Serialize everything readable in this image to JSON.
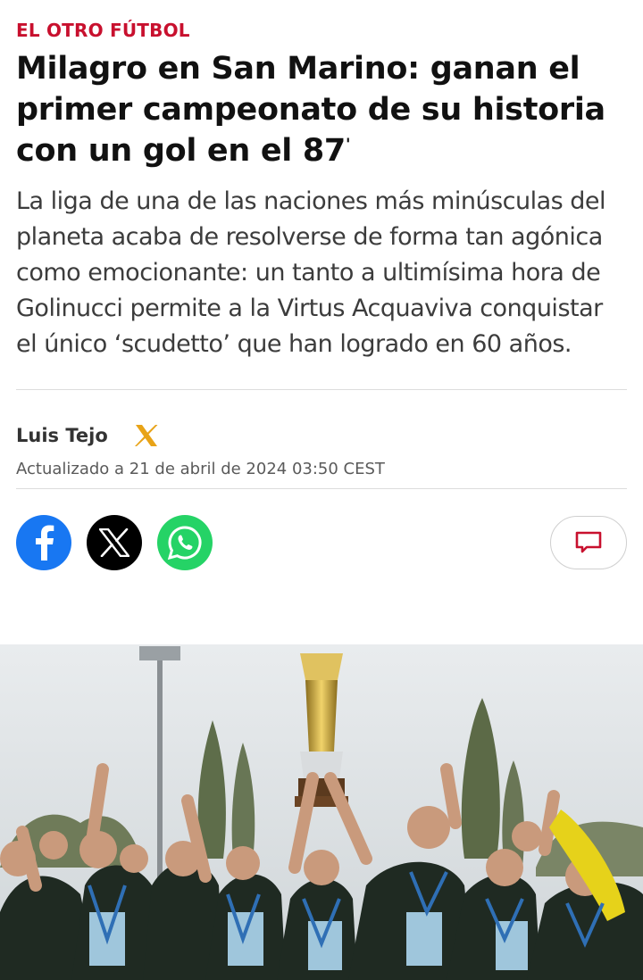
{
  "article": {
    "section": "EL OTRO FÚTBOL",
    "headline": "Milagro en San Marino: ganan el primer campeonato de su historia con un gol en el 87",
    "headline_minute_mark": "'",
    "subhead": "La liga de una de las naciones más minúsculas del planeta acaba de resolverse de forma tan agónica como emocionante: un tanto a ultimísima hora de Golinucci permite a la Virtus Acquaviva conquistar el único ‘scudetto’ que han logrado en 60 años.",
    "author": "Luis Tejo",
    "updated": "Actualizado a 21 de abril de 2024 03:50 CEST"
  },
  "share": {
    "buttons": [
      {
        "icon": "facebook-icon",
        "color": "#1877f2"
      },
      {
        "icon": "x-icon",
        "color": "#000000"
      },
      {
        "icon": "whatsapp-icon",
        "color": "#25d366"
      }
    ],
    "comments_icon": "comment-icon"
  },
  "colors": {
    "accent": "#c8102e",
    "author_x_icon": "#e8a317"
  }
}
